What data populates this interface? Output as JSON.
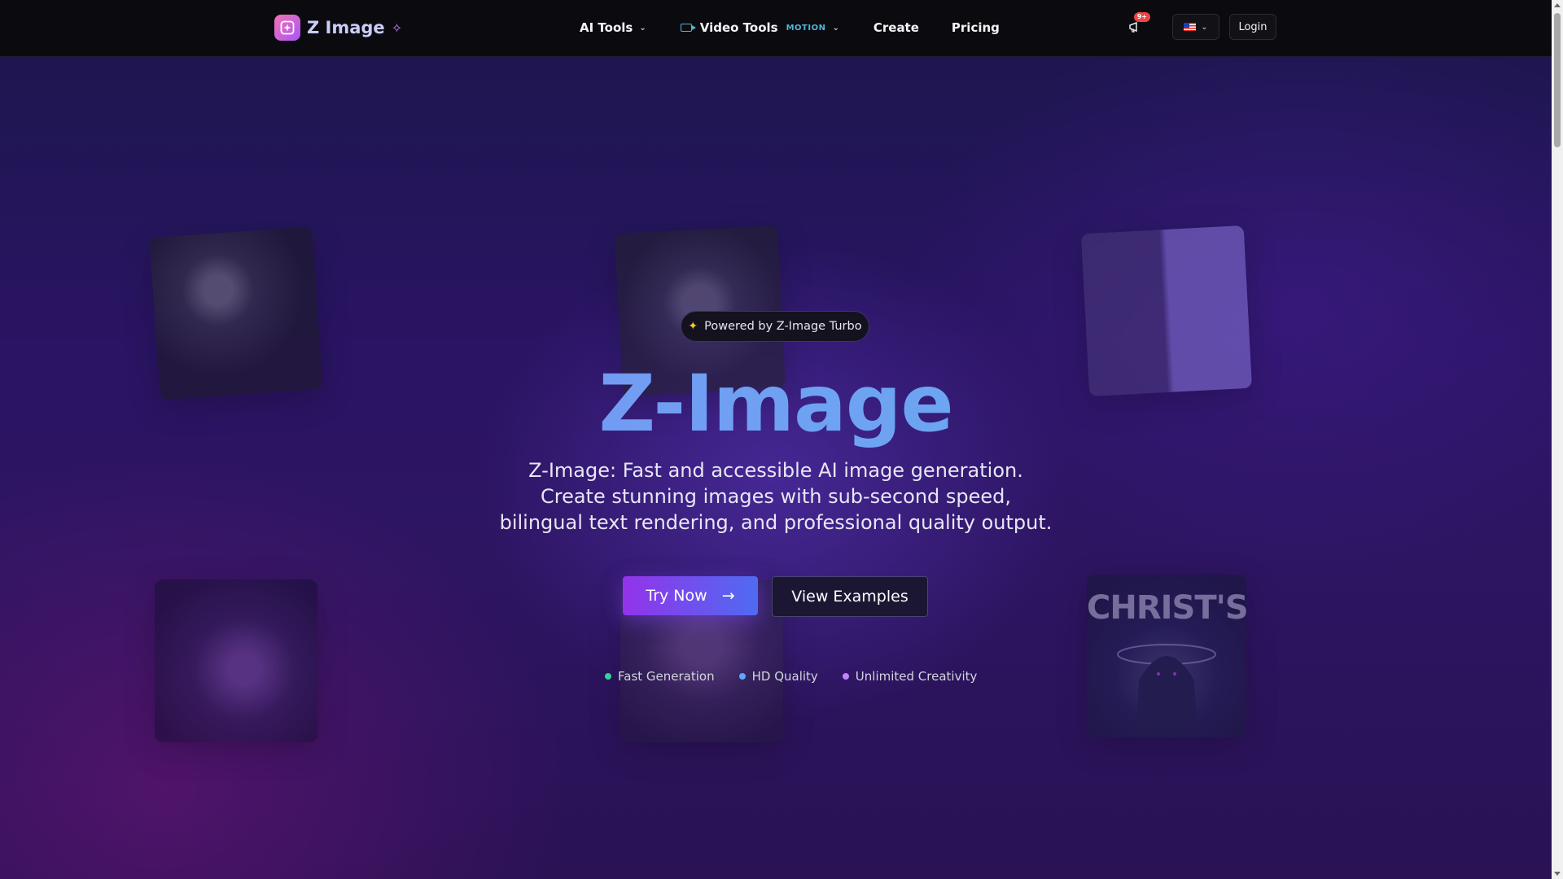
{
  "brand": {
    "name": "Z Image"
  },
  "nav": {
    "items": [
      {
        "label": "AI Tools"
      },
      {
        "label": "Video Tools",
        "tag": "MOTION"
      },
      {
        "label": "Create"
      },
      {
        "label": "Pricing"
      }
    ],
    "notification_badge": "9+",
    "login_label": "Login"
  },
  "hero": {
    "pill_text": "Powered by Z-Image Turbo",
    "title": "Z-Image",
    "subtitle_lines": [
      "Z-Image: Fast and accessible AI image generation.",
      "Create stunning images with sub-second speed,",
      "bilingual text rendering, and professional quality output."
    ],
    "primary_button": "Try Now",
    "secondary_button": "View Examples",
    "features": [
      {
        "label": "Fast Generation",
        "color": "#34d399"
      },
      {
        "label": "HD Quality",
        "color": "#60a5fa"
      },
      {
        "label": "Unlimited Creativity",
        "color": "#c084fc"
      }
    ],
    "tile_texts": {
      "hoodie": "CHRIST'SON"
    }
  },
  "colors": {
    "accent": "#9333ea",
    "accent2": "#4f6bf2",
    "navbar": "#0b0b0f",
    "badge": "#ef4444"
  }
}
